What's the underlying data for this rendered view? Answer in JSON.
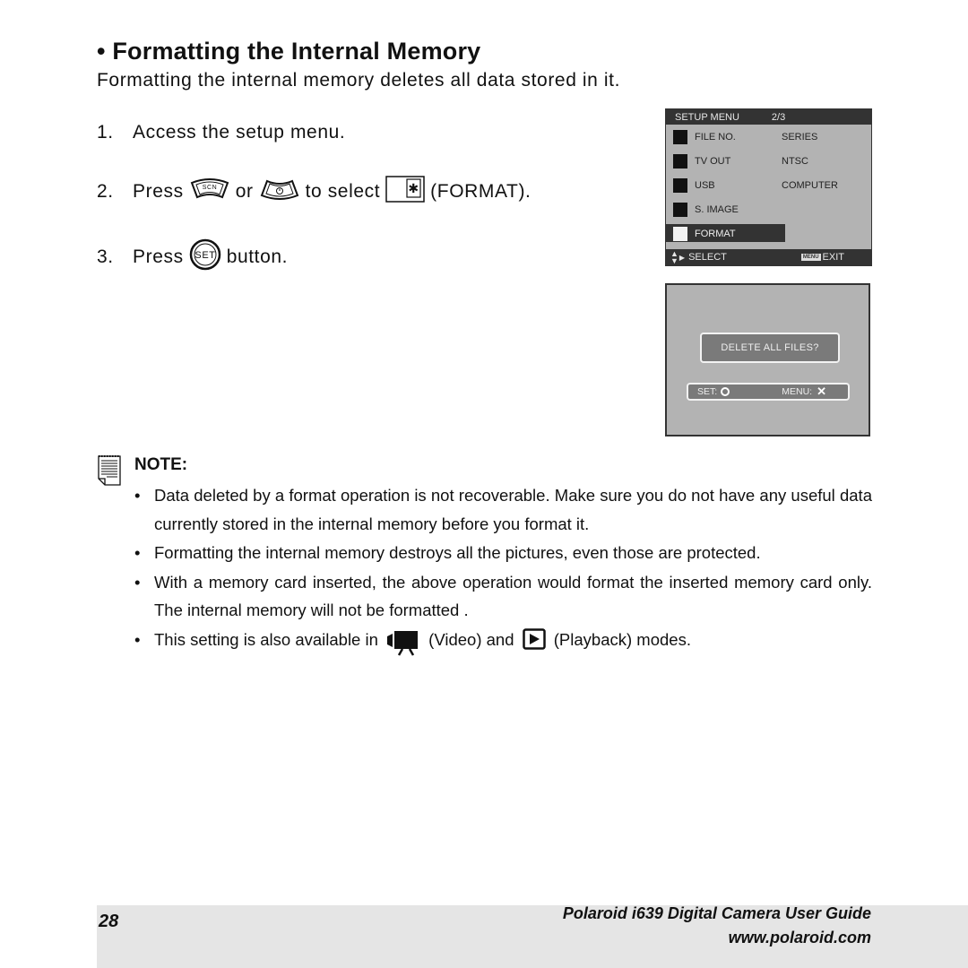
{
  "section": {
    "title": "• Formatting the Internal Memory",
    "intro": "Formatting the internal memory deletes all data stored in it."
  },
  "steps": [
    {
      "num": "1.",
      "text": "Access the setup menu."
    },
    {
      "num": "2.",
      "press": "Press",
      "or": "or",
      "to_select": "to select",
      "format_label": "(FORMAT).",
      "scn_button_label": "SCN"
    },
    {
      "num": "3.",
      "press": "Press",
      "set_button_label": "SET",
      "suffix": "button."
    }
  ],
  "setup_menu": {
    "header": "SETUP MENU",
    "page": "2/3",
    "rows": [
      {
        "icon": "file-number-icon",
        "label": "FILE NO.",
        "value": "SERIES",
        "selected": false
      },
      {
        "icon": "tv-out-icon",
        "label": "TV OUT",
        "value": "NTSC",
        "selected": false
      },
      {
        "icon": "usb-icon",
        "label": "USB",
        "value": "COMPUTER",
        "selected": false
      },
      {
        "icon": "startup-image-icon",
        "label": "S. IMAGE",
        "value": "",
        "selected": false
      },
      {
        "icon": "format-icon",
        "label": "FORMAT",
        "value": "",
        "selected": true
      }
    ],
    "footer": {
      "select": "SELECT",
      "menu_chip": "MENU",
      "exit": "EXIT"
    }
  },
  "confirm_dialog": {
    "question": "DELETE ALL FILES?",
    "set_label": "SET:",
    "menu_label": "MENU:",
    "cancel_glyph": "✕"
  },
  "note": {
    "title": "NOTE:",
    "items": [
      "Data deleted by a format operation is not recoverable. Make sure you do not have any useful data currently stored in the internal memory before you format it.",
      "Formatting the internal memory destroys all the pictures, even those are protected.",
      "With a memory card inserted, the above operation would format the inserted memory card only. The internal memory will not be formatted ."
    ],
    "last_item": {
      "prefix": "This setting is also available in",
      "video": "(Video) and",
      "playback": "(Playback) modes."
    }
  },
  "footer": {
    "page_number": "28",
    "guide_title": "Polaroid i639 Digital Camera User Guide",
    "url": "www.polaroid.com"
  }
}
